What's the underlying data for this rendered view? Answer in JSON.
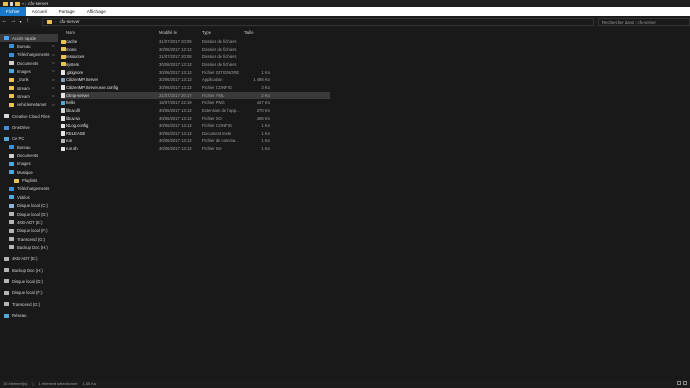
{
  "window": {
    "title": "cfx-server"
  },
  "ribbon": {
    "tabs": [
      "Fichier",
      "Accueil",
      "Partage",
      "Affichage"
    ]
  },
  "address": {
    "path": "cfx-server",
    "search_placeholder": "Rechercher dans : cfx-server"
  },
  "columns": {
    "name": "Nom",
    "date": "Modifié le",
    "type": "Type",
    "size": "Taille"
  },
  "sidebar": {
    "items": [
      {
        "label": "Accès rapide",
        "icon": "star-icon",
        "color": "#4aa3ff",
        "selected": true,
        "indent": 0,
        "pinned": false
      },
      {
        "label": "Bureau",
        "icon": "desktop-icon",
        "color": "#3d8fd6",
        "indent": 1,
        "pinned": true
      },
      {
        "label": "Téléchargements",
        "icon": "download-icon",
        "color": "#3d8fd6",
        "indent": 1,
        "pinned": true
      },
      {
        "label": "Documents",
        "icon": "documents-icon",
        "color": "#cfcfcf",
        "indent": 1,
        "pinned": true
      },
      {
        "label": "Images",
        "icon": "images-icon",
        "color": "#4fa8d8",
        "indent": 1,
        "pinned": true
      },
      {
        "label": "_trunk",
        "icon": "folder-icon",
        "color": "#e8c157",
        "indent": 1,
        "pinned": true
      },
      {
        "label": "stream",
        "icon": "folder-icon",
        "color": "#e8c157",
        "indent": 1,
        "pinned": true
      },
      {
        "label": "stream",
        "icon": "folder-icon",
        "color": "#e8c157",
        "indent": 1,
        "pinned": true
      },
      {
        "label": "vehiclemetamet",
        "icon": "folder-icon",
        "color": "#e8c157",
        "indent": 1,
        "pinned": true
      },
      {
        "label": "Creative Cloud Files",
        "icon": "creative-cloud-icon",
        "color": "#d9d9d9",
        "indent": 0,
        "gap": true
      },
      {
        "label": "OneDrive",
        "icon": "onedrive-icon",
        "color": "#3d8fd6",
        "indent": 0,
        "gap": true
      },
      {
        "label": "Ce PC",
        "icon": "computer-icon",
        "color": "#4fa8d8",
        "indent": 0,
        "gap": true
      },
      {
        "label": "Bureau",
        "icon": "desktop-icon",
        "color": "#3d8fd6",
        "indent": 1
      },
      {
        "label": "Documents",
        "icon": "documents-icon",
        "color": "#cfcfcf",
        "indent": 1
      },
      {
        "label": "Images",
        "icon": "images-icon",
        "color": "#4fa8d8",
        "indent": 1
      },
      {
        "label": "Musique",
        "icon": "music-icon",
        "color": "#4fa8d8",
        "indent": 1
      },
      {
        "label": "Playlists",
        "icon": "folder-icon",
        "color": "#e8c157",
        "indent": 2
      },
      {
        "label": "Téléchargements",
        "icon": "download-icon",
        "color": "#3d8fd6",
        "indent": 1
      },
      {
        "label": "Vidéos",
        "icon": "video-icon",
        "color": "#4fa8d8",
        "indent": 1
      },
      {
        "label": "Disque local (C:)",
        "icon": "drive-icon",
        "color": "#8fb6d6",
        "indent": 1
      },
      {
        "label": "Disque local (D:)",
        "icon": "drive-icon",
        "color": "#b5b5b5",
        "indent": 1
      },
      {
        "label": "4KB-ADT (E:)",
        "icon": "drive-icon",
        "color": "#b5b5b5",
        "indent": 1
      },
      {
        "label": "Disque local (F:)",
        "icon": "drive-icon",
        "color": "#b5b5b5",
        "indent": 1
      },
      {
        "label": "Transcend (G:)",
        "icon": "drive-icon",
        "color": "#b5b5b5",
        "indent": 1
      },
      {
        "label": "Backup Doc (H:)",
        "icon": "drive-icon",
        "color": "#b5b5b5",
        "indent": 1
      },
      {
        "label": "4KB-ADT (E:)",
        "icon": "drive-icon",
        "color": "#b5b5b5",
        "indent": 0,
        "gap": true
      },
      {
        "label": "Backup Doc (H:)",
        "icon": "drive-icon",
        "color": "#b5b5b5",
        "indent": 0,
        "gap": true
      },
      {
        "label": "Disque local (D:)",
        "icon": "drive-icon",
        "color": "#b5b5b5",
        "indent": 0,
        "gap": true
      },
      {
        "label": "Disque local (F:)",
        "icon": "drive-icon",
        "color": "#b5b5b5",
        "indent": 0,
        "gap": true
      },
      {
        "label": "Transcend (G:)",
        "icon": "drive-icon",
        "color": "#b5b5b5",
        "indent": 0,
        "gap": true
      },
      {
        "label": "Réseau",
        "icon": "network-icon",
        "color": "#4fa8d8",
        "indent": 0,
        "gap": true
      }
    ]
  },
  "files": [
    {
      "name": "cache",
      "date": "31/07/2017 20:08",
      "type": "Dossier de fichiers",
      "size": "",
      "icon": "folder-icon",
      "color": "#e8c157"
    },
    {
      "name": "mono",
      "date": "30/06/2017 13:13",
      "type": "Dossier de fichiers",
      "size": "",
      "icon": "folder-icon",
      "color": "#e8c157"
    },
    {
      "name": "resources",
      "date": "31/07/2017 20:08",
      "type": "Dossier de fichiers",
      "size": "",
      "icon": "folder-icon",
      "color": "#e8c157"
    },
    {
      "name": "system",
      "date": "30/06/2017 13:13",
      "type": "Dossier de fichiers",
      "size": "",
      "icon": "folder-icon",
      "color": "#e8c157"
    },
    {
      "name": ".gitignore",
      "date": "30/06/2017 13:13",
      "type": "Fichier GITIGNORE",
      "size": "1 Ko",
      "icon": "file-icon",
      "color": "#e6e6e6"
    },
    {
      "name": "CitizenMP.Server",
      "date": "30/06/2017 13:13",
      "type": "Application",
      "size": "1 498 Ko",
      "icon": "app-icon",
      "color": "#7a9cc6"
    },
    {
      "name": "CitizenMP.Server.exe.config",
      "date": "30/06/2017 13:13",
      "type": "Fichier CONFIG",
      "size": "3 Ko",
      "icon": "file-icon",
      "color": "#e6e6e6"
    },
    {
      "name": "citmp-server",
      "date": "31/07/2017 20:17",
      "type": "Fichier YML",
      "size": "2 Ko",
      "icon": "file-icon",
      "color": "#e6e6e6",
      "selected": true
    },
    {
      "name": "hello",
      "date": "15/07/2017 22:19",
      "type": "Fichier PNG",
      "size": "427 Ko",
      "icon": "image-file-icon",
      "color": "#4fa8d8"
    },
    {
      "name": "libuv.dll",
      "date": "30/06/2017 13:13",
      "type": "Extension de l'app...",
      "size": "270 Ko",
      "icon": "dll-icon",
      "color": "#d8d8d8"
    },
    {
      "name": "libuv.so",
      "date": "30/06/2017 13:13",
      "type": "Fichier SO",
      "size": "468 Ko",
      "icon": "file-icon",
      "color": "#e6e6e6"
    },
    {
      "name": "NLog.config",
      "date": "30/06/2017 13:13",
      "type": "Fichier CONFIG",
      "size": "1 Ko",
      "icon": "file-icon",
      "color": "#e6e6e6"
    },
    {
      "name": "RELEASE",
      "date": "30/06/2017 13:13",
      "type": "Document texte",
      "size": "1 Ko",
      "icon": "text-file-icon",
      "color": "#e6e6e6"
    },
    {
      "name": "run",
      "date": "30/06/2017 13:13",
      "type": "Fichier de comma...",
      "size": "1 Ko",
      "icon": "batch-icon",
      "color": "#b8b8b8"
    },
    {
      "name": "run.sh",
      "date": "30/06/2017 13:13",
      "type": "Fichier SH",
      "size": "1 Ko",
      "icon": "file-icon",
      "color": "#e6e6e6"
    }
  ],
  "status": {
    "count": "15 élément(s)",
    "selection": "1 élément sélectionné",
    "size": "1,55 Ko"
  }
}
